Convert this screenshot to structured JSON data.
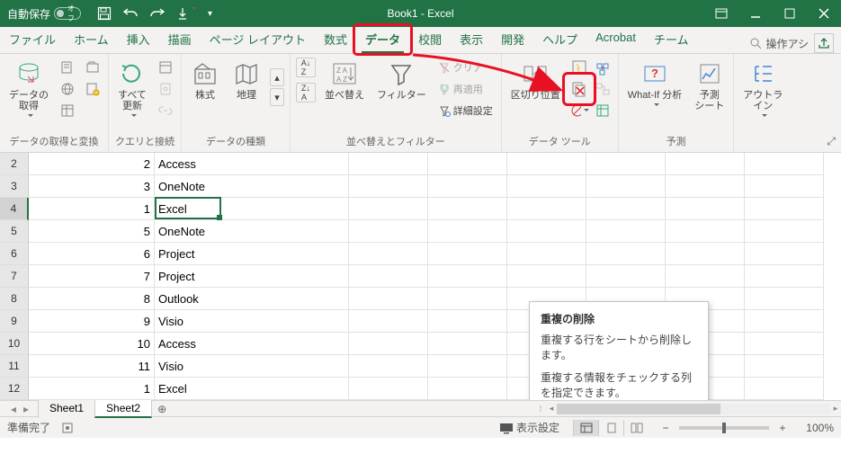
{
  "title": "Book1 - Excel",
  "autosave_label": "自動保存",
  "autosave_state": "オフ",
  "tabs": [
    "ファイル",
    "ホーム",
    "挿入",
    "描画",
    "ページ レイアウト",
    "数式",
    "データ",
    "校閲",
    "表示",
    "開発",
    "ヘルプ",
    "Acrobat",
    "チーム"
  ],
  "active_tab_index": 6,
  "tell_me": "操作アシ",
  "ribbon": {
    "g1": {
      "label": "データの取得と変換",
      "btn": "データの\n取得"
    },
    "g2": {
      "label": "クエリと接続",
      "btn": "すべて\n更新"
    },
    "g3": {
      "label": "データの種類",
      "stocks": "株式",
      "geo": "地理"
    },
    "g4": {
      "label": "並べ替えとフィルター",
      "sort": "並べ替え",
      "filter": "フィルター",
      "clear": "クリア",
      "reapply": "再適用",
      "advanced": "詳細設定"
    },
    "g5": {
      "label": "データ ツール",
      "text_to_col": "区切り位置"
    },
    "g6": {
      "label": "予測",
      "whatif": "What-If 分析",
      "forecast": "予測\nシート"
    },
    "g7": {
      "outline": "アウトラ\nイン"
    }
  },
  "tooltip": {
    "title": "重複の削除",
    "line1": "重複する行をシートから削除します。",
    "line2": "重複する情報をチェックする列を指定できます。"
  },
  "rows": [
    {
      "n": "2",
      "a": "2",
      "b": "Access"
    },
    {
      "n": "3",
      "a": "3",
      "b": "OneNote"
    },
    {
      "n": "4",
      "a": "1",
      "b": "Excel"
    },
    {
      "n": "5",
      "a": "5",
      "b": "OneNote"
    },
    {
      "n": "6",
      "a": "6",
      "b": "Project"
    },
    {
      "n": "7",
      "a": "7",
      "b": "Project"
    },
    {
      "n": "8",
      "a": "8",
      "b": "Outlook"
    },
    {
      "n": "9",
      "a": "9",
      "b": "Visio"
    },
    {
      "n": "10",
      "a": "10",
      "b": "Access"
    },
    {
      "n": "11",
      "a": "11",
      "b": "Visio"
    },
    {
      "n": "12",
      "a": "1",
      "b": "Excel"
    }
  ],
  "active_row_index": 2,
  "sheets": {
    "tabs": [
      "Sheet1",
      "Sheet2"
    ],
    "active": 1
  },
  "status": {
    "ready": "準備完了",
    "display": "表示設定",
    "zoom": "100%"
  }
}
